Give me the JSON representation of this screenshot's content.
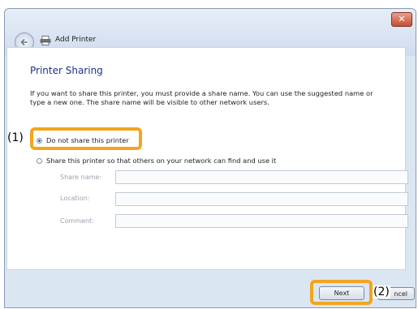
{
  "window": {
    "title": "Add Printer",
    "close_glyph": "✕"
  },
  "page": {
    "heading": "Printer Sharing",
    "description": "If you want to share this printer, you must provide a share name. You can use the suggested name or type a new one. The share name will be visible to other network users."
  },
  "options": {
    "no_share_label": "Do not share this printer",
    "share_label": "Share this printer so that others on your network can find and use it",
    "selected": "no_share"
  },
  "fields": {
    "share_name_label": "Share name:",
    "share_name_value": "",
    "location_label": "Location:",
    "location_value": "",
    "comment_label": "Comment:",
    "comment_value": ""
  },
  "callouts": {
    "one": "(1)",
    "two": "(2)"
  },
  "buttons": {
    "next": "Next",
    "cancel_visible": "ncel"
  },
  "colors": {
    "highlight": "#f2a51c",
    "heading": "#1e3287"
  },
  "icons": {
    "back": "back-arrow-icon",
    "printer": "printer-icon",
    "close": "close-icon"
  }
}
